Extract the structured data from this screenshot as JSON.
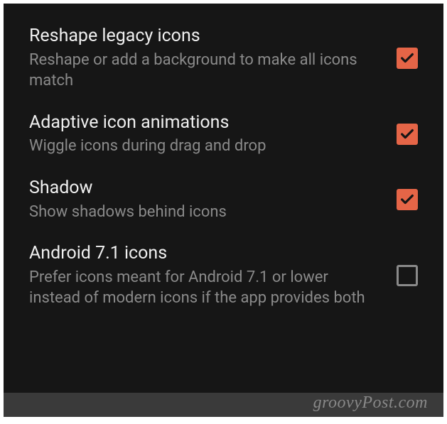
{
  "settings": [
    {
      "title": "Reshape legacy icons",
      "description": "Reshape or add a background to make all icons match",
      "checked": true
    },
    {
      "title": "Adaptive icon animations",
      "description": "Wiggle icons during drag and drop",
      "checked": true
    },
    {
      "title": "Shadow",
      "description": "Show shadows behind icons",
      "checked": true
    },
    {
      "title": "Android 7.1 icons",
      "description": "Prefer icons meant for Android 7.1 or lower instead of modern icons if the app provides both",
      "checked": false
    }
  ],
  "watermark": "groovyPost.com"
}
